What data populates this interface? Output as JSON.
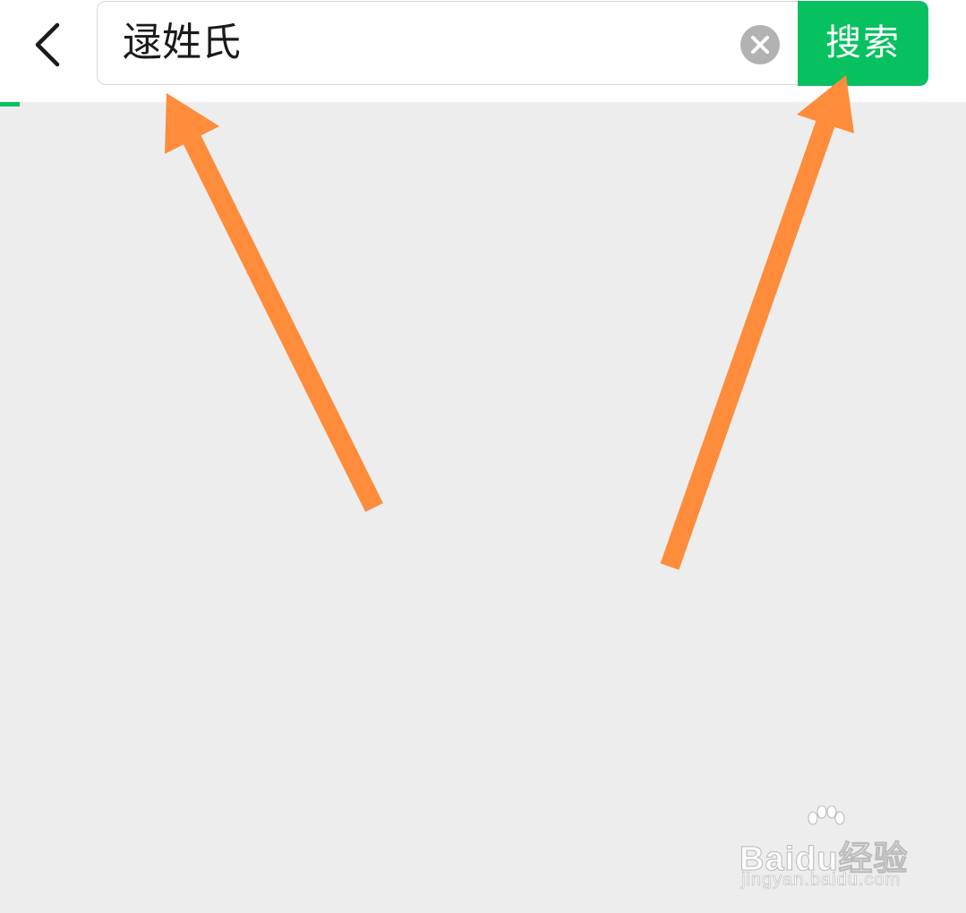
{
  "header": {
    "back_icon": "chevron-left-icon",
    "search": {
      "value": "逯姓氏",
      "clear_icon": "clear-circle-icon",
      "button_label": "搜索"
    }
  },
  "annotations": {
    "arrow_color": "#ff8c3a",
    "arrows": [
      "arrow-to-search-input",
      "arrow-to-search-button"
    ]
  },
  "watermark": {
    "brand": "Baidu经验",
    "url": "jingyan.baidu.com"
  },
  "colors": {
    "accent": "#07c160",
    "background": "#ededed",
    "header": "#ffffff"
  }
}
